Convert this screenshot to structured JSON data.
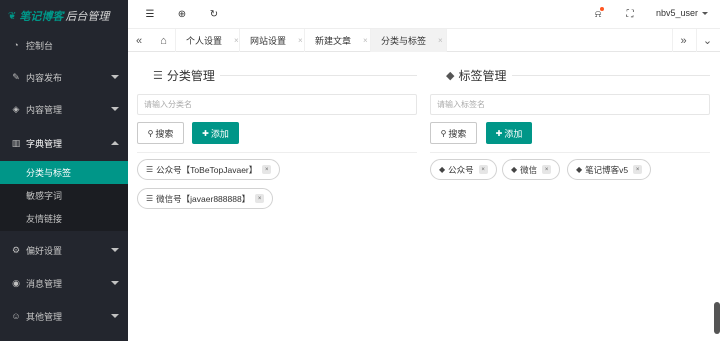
{
  "app": {
    "brand": "笔记博客",
    "suffix": "后台管理"
  },
  "sidebar": {
    "items": [
      {
        "label": "控制台",
        "icon": "dashboard-icon"
      },
      {
        "label": "内容发布",
        "icon": "edit-icon"
      },
      {
        "label": "内容管理",
        "icon": "layers-icon"
      },
      {
        "label": "字典管理",
        "icon": "book-icon"
      },
      {
        "label": "偏好设置",
        "icon": "gear-icon"
      },
      {
        "label": "消息管理",
        "icon": "eye-icon"
      },
      {
        "label": "其他管理",
        "icon": "user-icon"
      }
    ],
    "dictionary_sub": [
      "分类与标签",
      "敏感字词",
      "友情链接"
    ]
  },
  "header": {
    "user": "nbv5_user"
  },
  "tabs": {
    "items": [
      {
        "label": "个人设置"
      },
      {
        "label": "网站设置"
      },
      {
        "label": "新建文章"
      },
      {
        "label": "分类与标签"
      }
    ],
    "close": "×"
  },
  "category": {
    "title": "分类管理",
    "placeholder": "请输入分类名",
    "search_label": "搜索",
    "add_label": "添加",
    "tags": [
      "公众号【ToBeTopJavaer】",
      "微信号【javaer888888】"
    ]
  },
  "label_panel": {
    "title": "标签管理",
    "placeholder": "请输入标签名",
    "search_label": "搜索",
    "add_label": "添加",
    "tags": [
      "公众号",
      "微信",
      "笔记博客v5"
    ]
  },
  "colors": {
    "accent": "#009688",
    "sidebar": "#23262e",
    "badge": "#ff5722"
  }
}
